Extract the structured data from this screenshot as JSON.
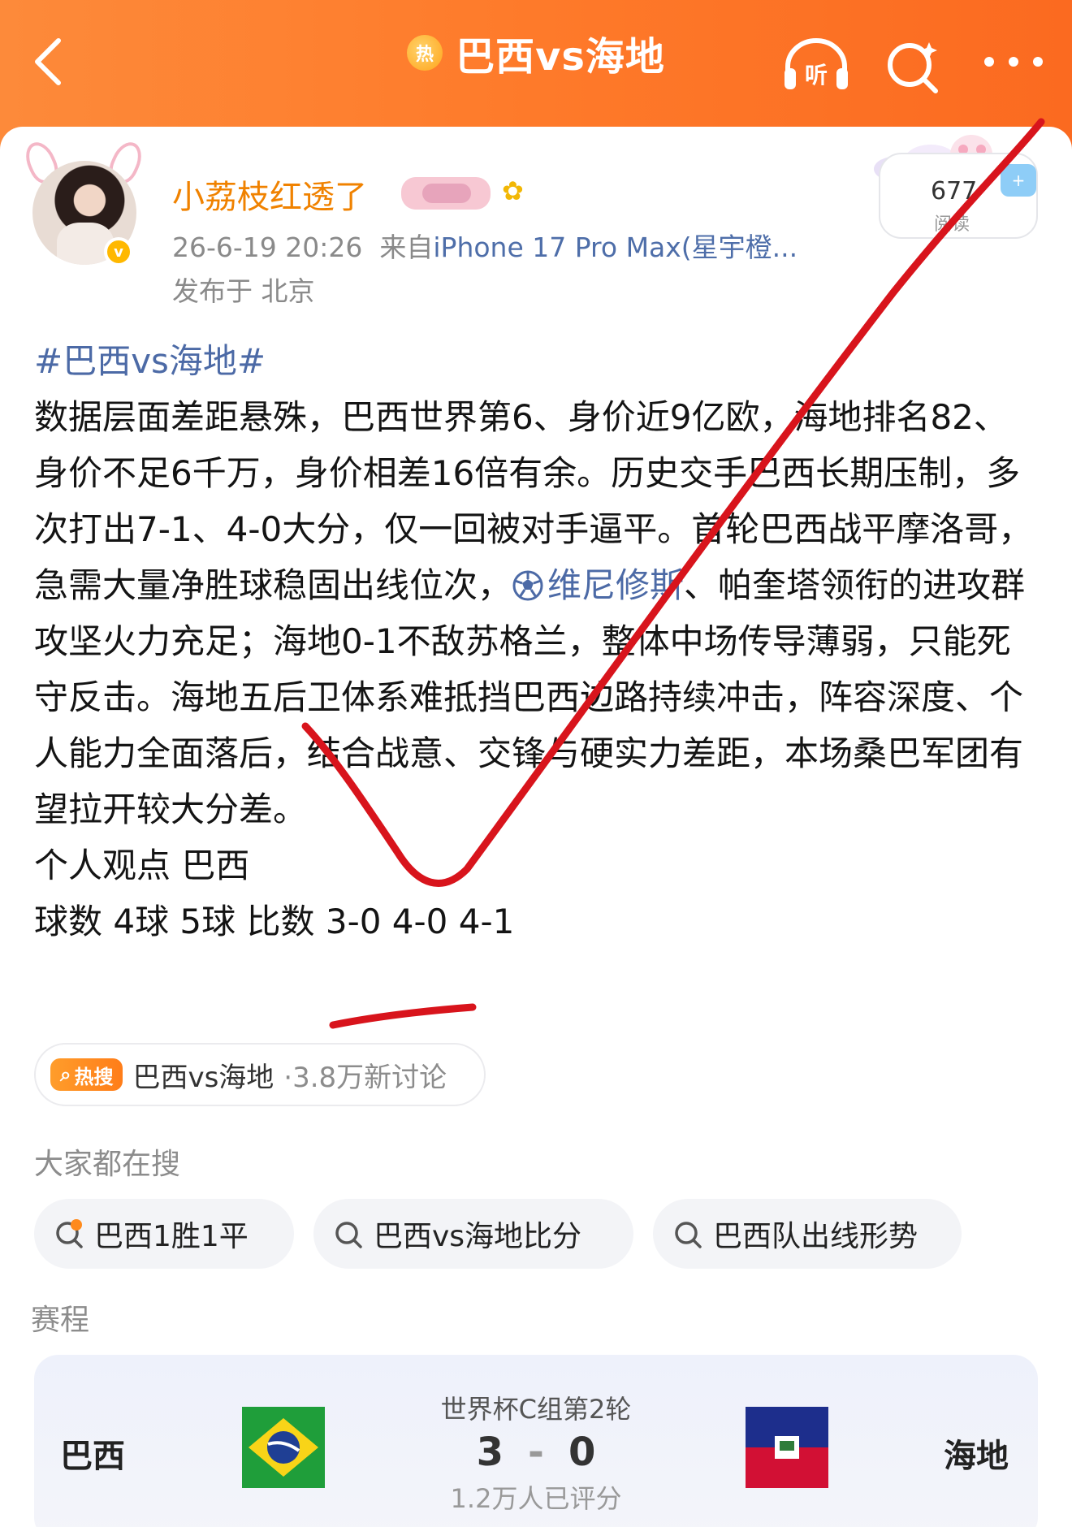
{
  "header": {
    "title": "巴西vs海地",
    "hot_badge": "热",
    "listen_label": "听"
  },
  "post": {
    "username": "小荔枝红透了",
    "timestamp": "26-6-19 20:26",
    "source_prefix": "来自",
    "device": "iPhone 17 Pro Max(星宇橙...",
    "location": "发布于 北京",
    "read_count": "677",
    "read_label": "阅读",
    "follow_label": "+",
    "verified": "v",
    "topic": "#巴西vs海地#",
    "body_1": "数据层面差距悬殊，巴西世界第6、身价近9亿欧，海地排名82、身价不足6千万，身价相差16倍有余。历史交手巴西长期压制，多次打出7-1、4-0大分，仅一回被对手逼平。首轮巴西战平摩洛哥，急需大量净胜球稳固出线位次，",
    "mention": "维尼修斯",
    "body_2": "、帕奎塔领衔的进攻群攻坚火力充足；海地0-1不敌苏格兰，整体中场传导薄弱，只能死守反击。海地五后卫体系难抵挡巴西边路持续冲击，阵容深度、个人能力全面落后，结合战意、交锋与硬实力差距，本场桑巴军团有望拉开较大分差。",
    "opinion": "个人观点 巴西",
    "goals": "球数  4球 5球  比数 3-0 4-0 4-1"
  },
  "hot_search": {
    "tag": "热搜",
    "name": "巴西vs海地",
    "count": "·3.8万新讨论"
  },
  "suggest": {
    "label": "大家都在搜",
    "items": [
      "巴西1胜1平",
      "巴西vs海地比分",
      "巴西队出线形势"
    ]
  },
  "schedule": {
    "label": "赛程",
    "home": "巴西",
    "away": "海地",
    "round": "世界杯C组第2轮",
    "home_score": "3",
    "away_score": "0",
    "score_sep": "-",
    "rated": "1.2万人已评分"
  },
  "colors": {
    "header_orange": "#fe7a2a",
    "username_orange": "#f08200",
    "link_blue": "#4c6aa6",
    "annotation_red": "#d8141c"
  }
}
